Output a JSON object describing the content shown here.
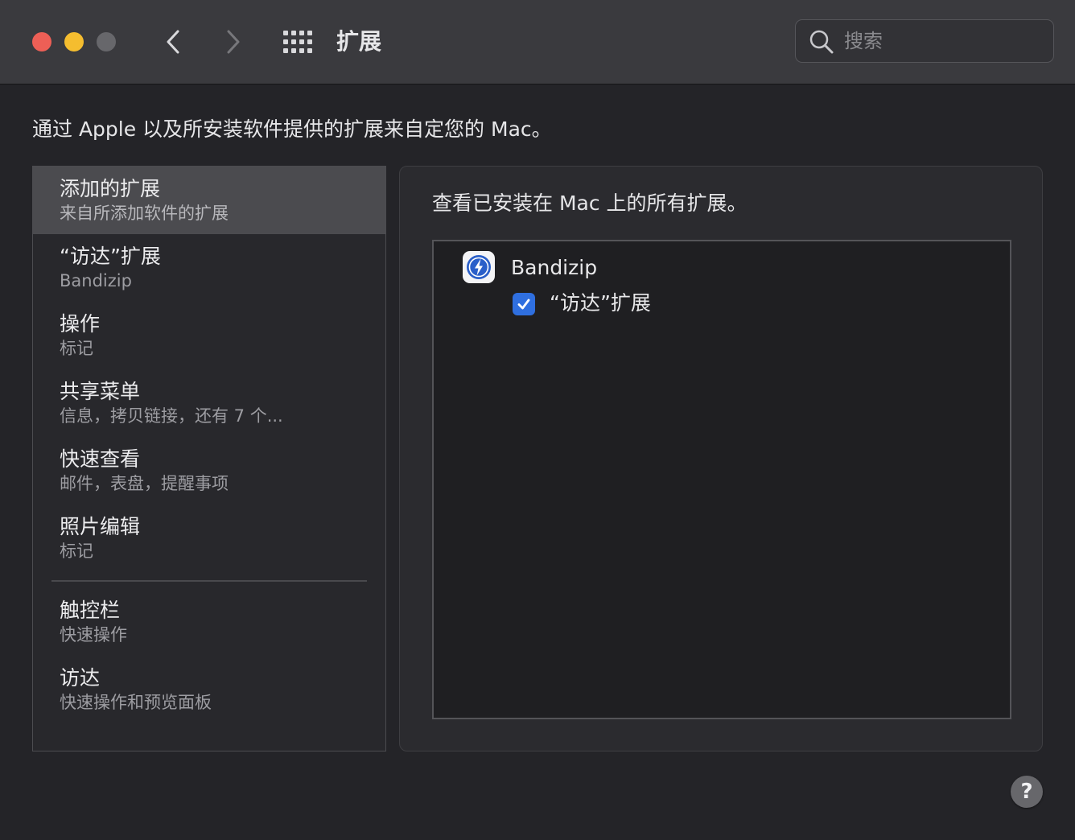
{
  "window": {
    "title": "扩展",
    "search_placeholder": "搜索",
    "description": "通过 Apple 以及所安装软件提供的扩展来自定您的 Mac。"
  },
  "sidebar": {
    "items": [
      {
        "title": "添加的扩展",
        "subtitle": "来自所添加软件的扩展",
        "selected": true
      },
      {
        "title": "“访达”扩展",
        "subtitle": "Bandizip"
      },
      {
        "title": "操作",
        "subtitle": "标记"
      },
      {
        "title": "共享菜单",
        "subtitle": "信息，拷贝链接，还有 7 个..."
      },
      {
        "title": "快速查看",
        "subtitle": "邮件，表盘，提醒事项"
      },
      {
        "title": "照片编辑",
        "subtitle": "标记"
      },
      {
        "title": "触控栏",
        "subtitle": "快速操作"
      },
      {
        "title": "访达",
        "subtitle": "快速操作和预览面板"
      }
    ]
  },
  "content": {
    "heading": "查看已安装在 Mac 上的所有扩展。",
    "apps": [
      {
        "name": "Bandizip",
        "icon": "bandizip-icon",
        "extensions": [
          {
            "label": "“访达”扩展",
            "checked": true
          }
        ]
      }
    ]
  },
  "help": {
    "label": "?"
  },
  "colors": {
    "close": "#ed5f56",
    "minimize": "#f5bd2f",
    "zoom_disabled": "#67676b",
    "accent": "#2f6fe0",
    "selection": "#4b4b4f"
  }
}
